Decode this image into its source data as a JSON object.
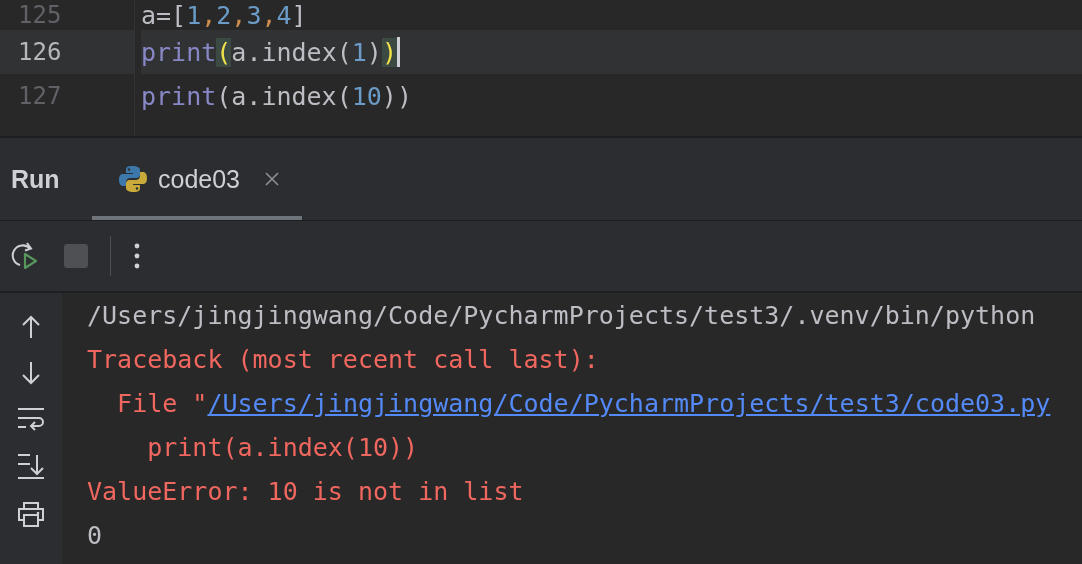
{
  "editor": {
    "lines": [
      {
        "number": "125",
        "current": false,
        "tokens": [
          {
            "text": "a=[",
            "kind": "plain"
          },
          {
            "text": "1",
            "kind": "number"
          },
          {
            "text": ",",
            "kind": "comma"
          },
          {
            "text": "2",
            "kind": "number"
          },
          {
            "text": ",",
            "kind": "comma"
          },
          {
            "text": "3",
            "kind": "number"
          },
          {
            "text": ",",
            "kind": "comma"
          },
          {
            "text": "4",
            "kind": "number"
          },
          {
            "text": "]",
            "kind": "plain"
          }
        ]
      },
      {
        "number": "126",
        "current": true,
        "tokens": [
          {
            "text": "print",
            "kind": "builtin"
          },
          {
            "text": "(",
            "kind": "match"
          },
          {
            "text": "a.index(",
            "kind": "plain"
          },
          {
            "text": "1",
            "kind": "number"
          },
          {
            "text": ")",
            "kind": "plain"
          },
          {
            "text": ")",
            "kind": "match"
          }
        ]
      },
      {
        "number": "127",
        "current": false,
        "tokens": [
          {
            "text": "print",
            "kind": "builtin"
          },
          {
            "text": "(a.index(",
            "kind": "plain"
          },
          {
            "text": "10",
            "kind": "number"
          },
          {
            "text": "))",
            "kind": "plain"
          }
        ]
      }
    ]
  },
  "run_panel": {
    "title": "Run",
    "tabs": [
      {
        "label": "code03",
        "selected": true
      }
    ]
  },
  "toolbar": {
    "stop_disabled": true
  },
  "console": {
    "lines": [
      {
        "segments": [
          {
            "text": "/Users/jingjingwang/Code/PycharmProjects/test3/.venv/bin/python",
            "kind": "plain"
          }
        ]
      },
      {
        "segments": [
          {
            "text": "Traceback (most recent call last):",
            "kind": "error"
          }
        ]
      },
      {
        "segments": [
          {
            "text": "  File \"",
            "kind": "error"
          },
          {
            "text": "/Users/jingjingwang/Code/PycharmProjects/test3/code03.py",
            "kind": "link"
          }
        ]
      },
      {
        "segments": [
          {
            "text": "    print(a.index(10))",
            "kind": "error"
          }
        ]
      },
      {
        "segments": [
          {
            "text": "ValueError: 10 is not in list",
            "kind": "error"
          }
        ]
      },
      {
        "segments": [
          {
            "text": "0",
            "kind": "plain"
          }
        ]
      }
    ]
  }
}
